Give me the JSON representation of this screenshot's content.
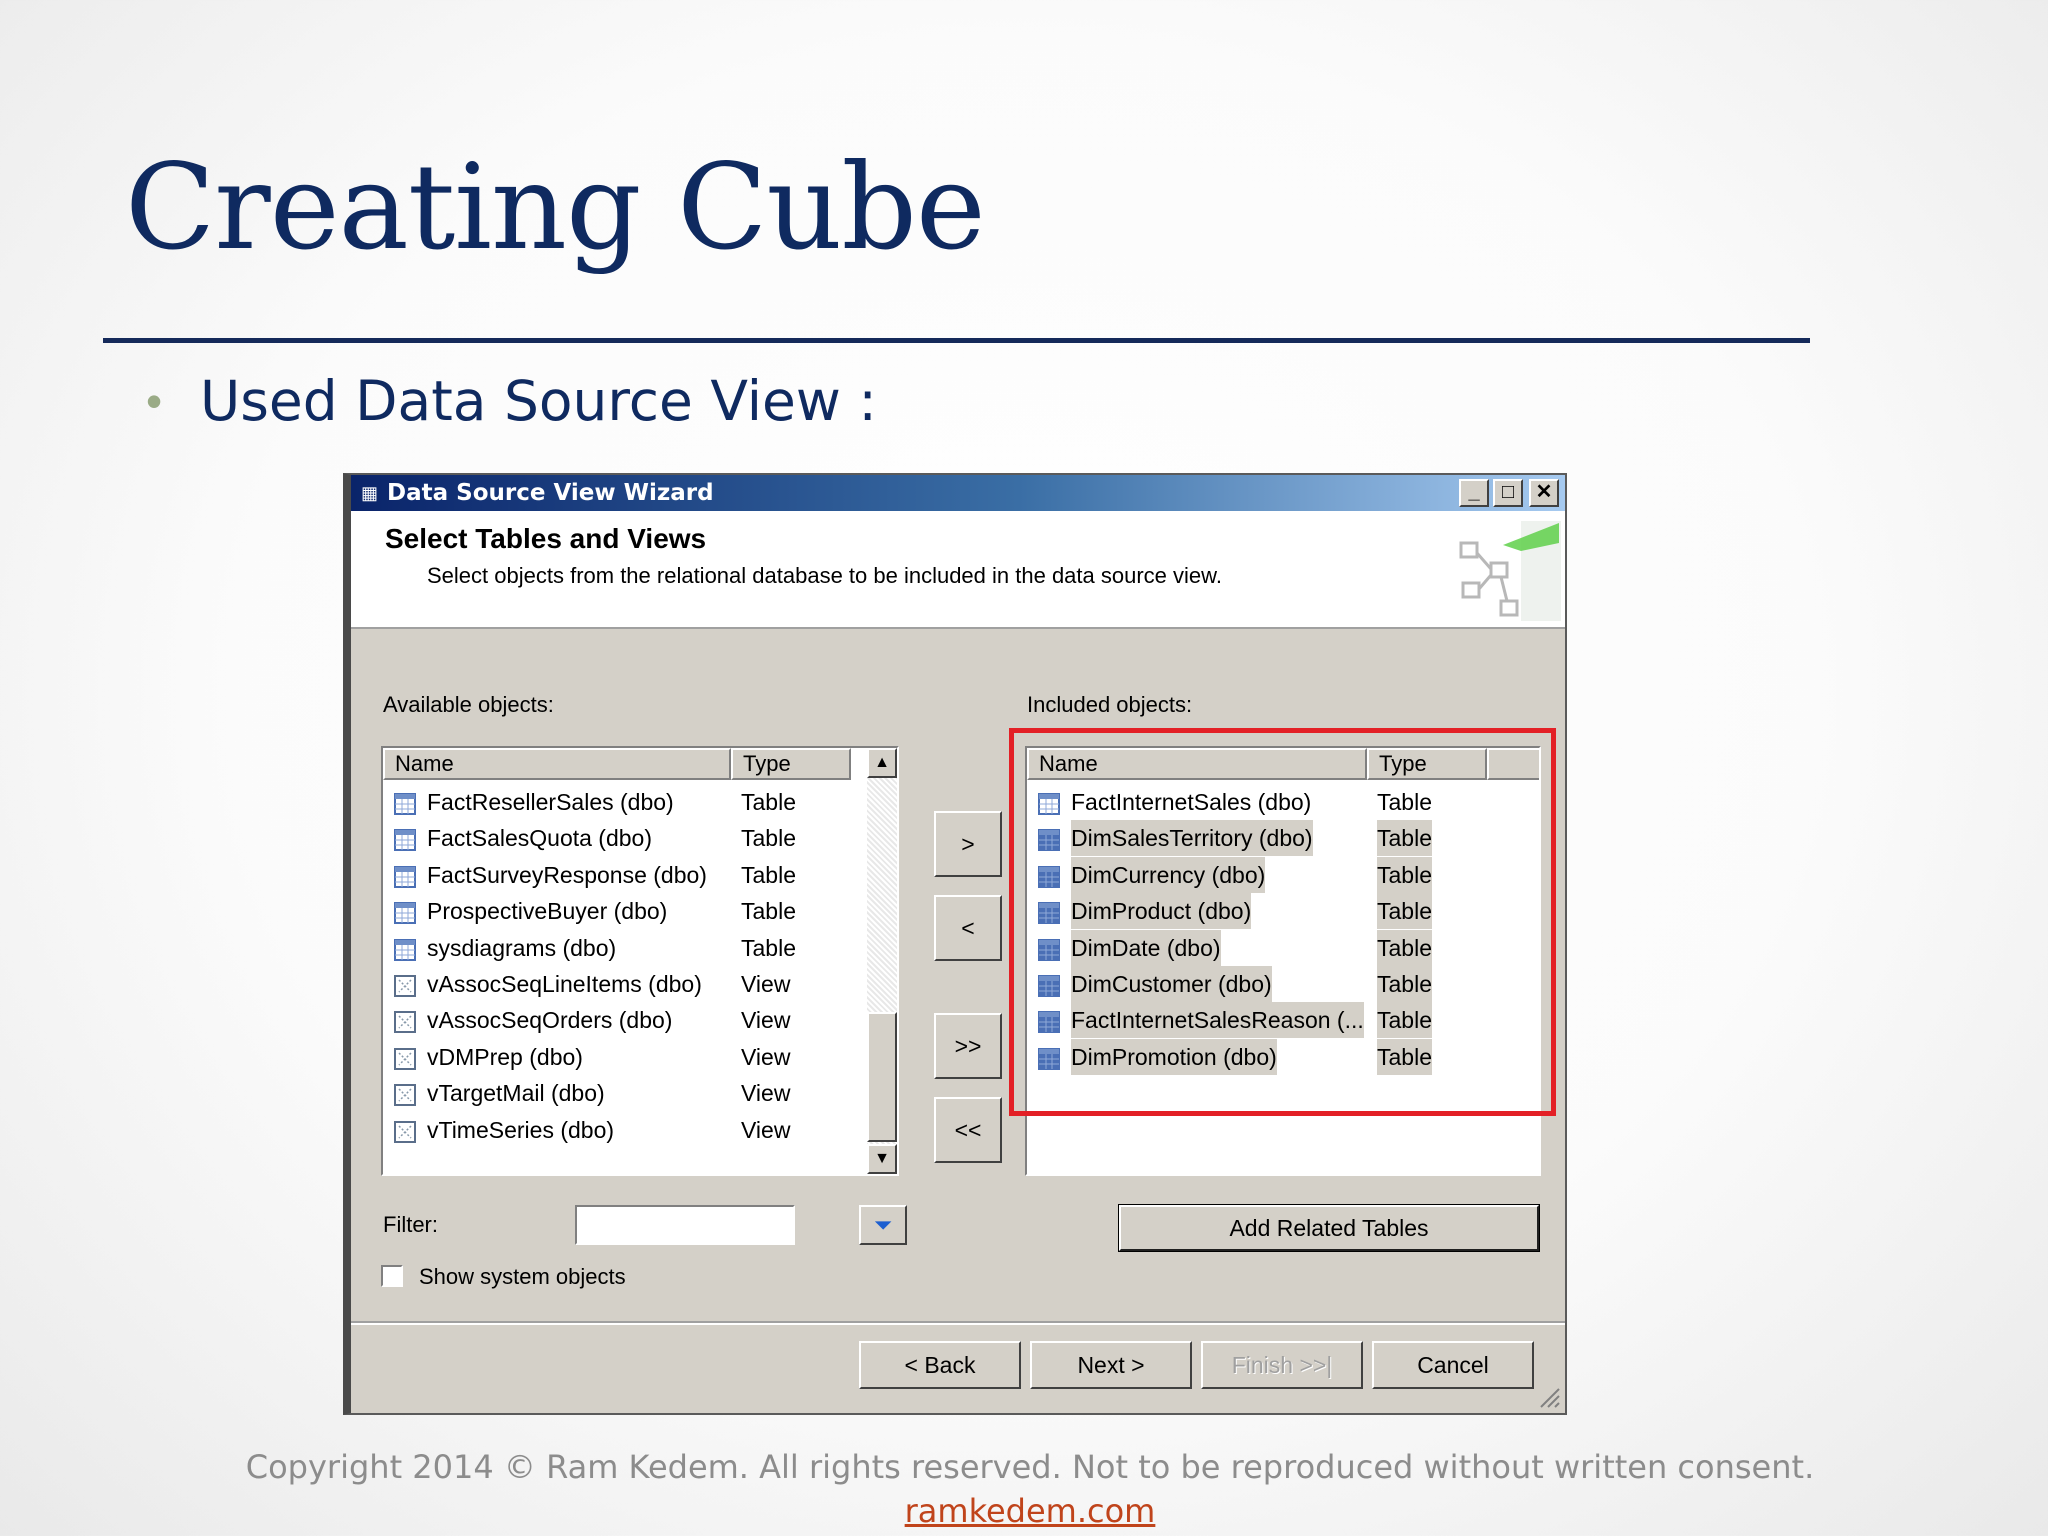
{
  "slide": {
    "title": "Creating Cube",
    "bullet": "Used Data Source View :",
    "footer": "Copyright 2014 © Ram Kedem. All rights reserved. Not to be reproduced without written consent.",
    "footer_link": "ramkedem.com"
  },
  "dialog": {
    "title": "Data Source View Wizard",
    "header_title": "Select Tables and Views",
    "header_subtitle": "Select objects from the relational database to be included in the data source view.",
    "available_label": "Available objects:",
    "included_label": "Included objects:",
    "columns": {
      "name": "Name",
      "type": "Type"
    },
    "available": [
      {
        "name": "FactResellerSales (dbo)",
        "type": "Table",
        "icon": "table-icon"
      },
      {
        "name": "FactSalesQuota (dbo)",
        "type": "Table",
        "icon": "table-icon"
      },
      {
        "name": "FactSurveyResponse (dbo)",
        "type": "Table",
        "icon": "table-icon"
      },
      {
        "name": "ProspectiveBuyer (dbo)",
        "type": "Table",
        "icon": "table-icon"
      },
      {
        "name": "sysdiagrams (dbo)",
        "type": "Table",
        "icon": "table-icon"
      },
      {
        "name": "vAssocSeqLineItems (dbo)",
        "type": "View",
        "icon": "view-icon"
      },
      {
        "name": "vAssocSeqOrders (dbo)",
        "type": "View",
        "icon": "view-icon"
      },
      {
        "name": "vDMPrep (dbo)",
        "type": "View",
        "icon": "view-icon"
      },
      {
        "name": "vTargetMail (dbo)",
        "type": "View",
        "icon": "view-icon"
      },
      {
        "name": "vTimeSeries (dbo)",
        "type": "View",
        "icon": "view-icon"
      }
    ],
    "included": [
      {
        "name": "FactInternetSales (dbo)",
        "type": "Table",
        "icon": "table-icon"
      },
      {
        "name": "DimSalesTerritory (dbo)",
        "type": "Table",
        "icon": "table-related-icon"
      },
      {
        "name": "DimCurrency (dbo)",
        "type": "Table",
        "icon": "table-related-icon"
      },
      {
        "name": "DimProduct (dbo)",
        "type": "Table",
        "icon": "table-related-icon"
      },
      {
        "name": "DimDate (dbo)",
        "type": "Table",
        "icon": "table-related-icon"
      },
      {
        "name": "DimCustomer (dbo)",
        "type": "Table",
        "icon": "table-related-icon"
      },
      {
        "name": "FactInternetSalesReason (...",
        "type": "Table",
        "icon": "table-related-icon"
      },
      {
        "name": "DimPromotion (dbo)",
        "type": "Table",
        "icon": "table-related-icon"
      }
    ],
    "move_buttons": {
      "add": ">",
      "remove": "<",
      "add_all": ">>",
      "remove_all": "<<"
    },
    "filter_label": "Filter:",
    "filter_value": "",
    "show_system_label": "Show system objects",
    "show_system_checked": false,
    "add_related_label": "Add Related Tables",
    "nav": {
      "back": "< Back",
      "next": "Next >",
      "finish": "Finish >>|",
      "cancel": "Cancel"
    },
    "highlight_color": "#e32026",
    "title_gradient": [
      "#0a246a",
      "#a6caf0"
    ]
  }
}
